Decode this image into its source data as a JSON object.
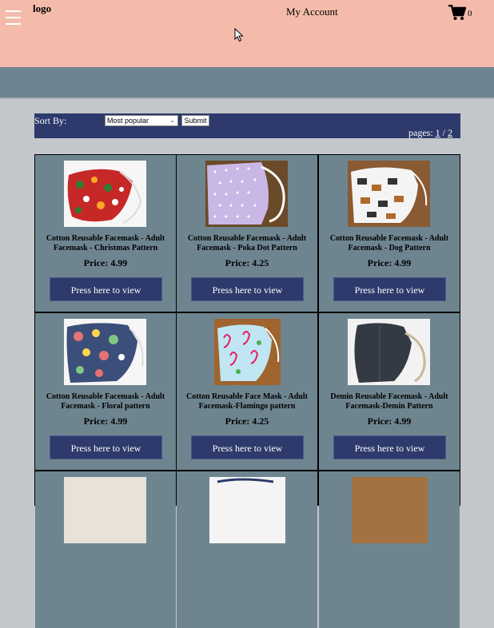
{
  "header": {
    "logo": "logo",
    "account": "My Account",
    "cart_count": "0"
  },
  "sort": {
    "label": "Sort By:",
    "selected": "Most popular",
    "submit": "Submit"
  },
  "pagination": {
    "label": "pages:",
    "current": "1",
    "separator": "/",
    "next": "2"
  },
  "products": [
    {
      "title": "Cotton Reusable Facemask - Adult Facemask - Christmas Pattern",
      "price": "Price: 4.99",
      "button": "Press here to view"
    },
    {
      "title": "Cotton Reusable Facemask - Adult Facemask - Poka Dot Pattern",
      "price": "Price: 4.25",
      "button": "Press here to view"
    },
    {
      "title": "Cotton Reusable Facemask - Adult Facemask - Dog Pattern",
      "price": "Price: 4.99",
      "button": "Press here to view"
    },
    {
      "title": "Cotton Reusable Facemask - Adult Facemask - Floral pattern",
      "price": "Price: 4.99",
      "button": "Press here to view"
    },
    {
      "title": "Cotton Reusable Face Mask - Adult Facemask-Flamingo pattern",
      "price": "Price: 4.25",
      "button": "Press here to view"
    },
    {
      "title": "Demin Reusable Facemask - Adult Facemask-Demin Pattern",
      "price": "Price: 4.99",
      "button": "Press here to view"
    }
  ],
  "colors": {
    "header_bg": "#f4bbaa",
    "band_bg": "#6d8590",
    "navy": "#2d3a6b",
    "cell_bg": "#6e8590"
  }
}
